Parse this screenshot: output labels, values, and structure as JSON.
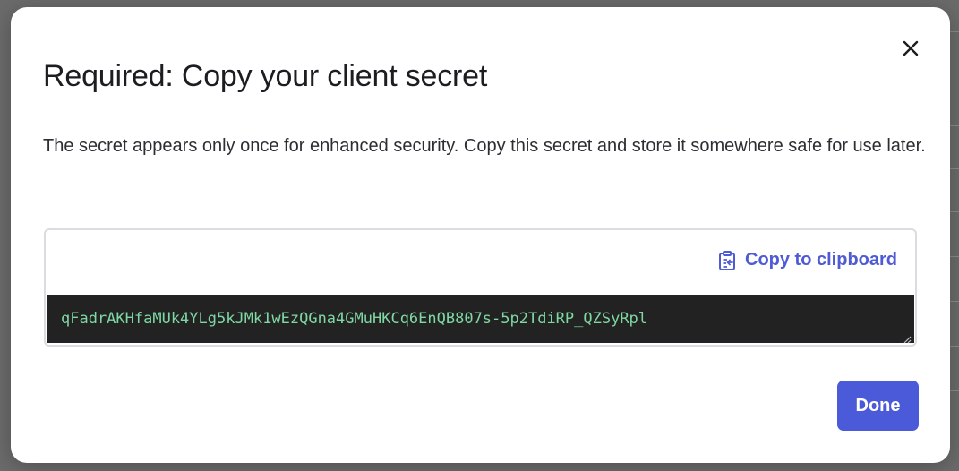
{
  "modal": {
    "title": "Required: Copy your client secret",
    "description": "The secret appears only once for enhanced security. Copy this secret and store it somewhere safe for use later.",
    "close_icon": "close-icon"
  },
  "secret": {
    "copy_label": "Copy to clipboard",
    "copy_icon": "clipboard-icon",
    "value": "qFadrAKHfaMUk4YLg5kJMk1wEzQGna4GMuHKCq6EnQB807s-5p2TdiRP_QZSyRpl"
  },
  "footer": {
    "done_label": "Done"
  },
  "colors": {
    "accent": "#4a5ad9",
    "link": "#4f5bd5",
    "secret_background": "#222222",
    "secret_text": "#7fd7a3",
    "backdrop": "#6b6b6b"
  }
}
